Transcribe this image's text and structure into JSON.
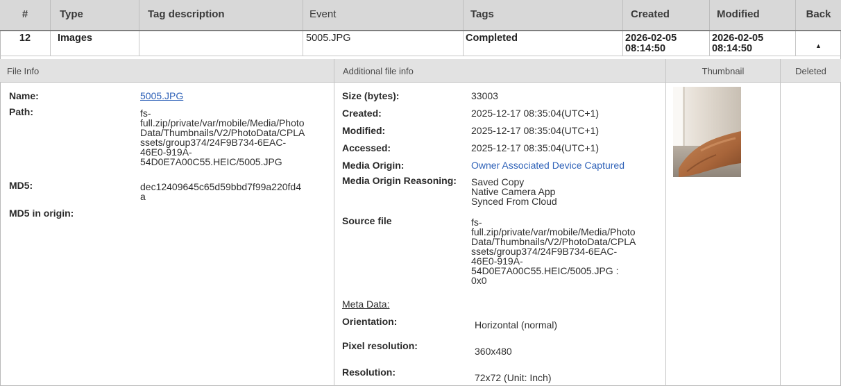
{
  "table": {
    "headers": [
      "#",
      "Type",
      "Tag description",
      "Event",
      "Tags",
      "Created",
      "Modified",
      "Back"
    ],
    "row": {
      "id": "12",
      "type": "Images",
      "tag_description": "",
      "event": "5005.JPG",
      "tags": "Completed",
      "created_date": "2026-02-05",
      "created_time": "08:14:50",
      "modified_date": "2026-02-05",
      "modified_time": "08:14:50",
      "back_icon": "▲"
    }
  },
  "sections": {
    "file_info": "File Info",
    "additional": "Additional file info",
    "thumbnail": "Thumbnail",
    "deleted": "Deleted"
  },
  "file_info": {
    "name_label": "Name:",
    "name_value": "5005.JPG",
    "path_label": "Path:",
    "path_lines": [
      "fs-",
      "full.zip/private/var/mobile/Media/Photo",
      "Data/Thumbnails/V2/PhotoData/CPLA",
      "ssets/group374/24F9B734-6EAC-",
      "46E0-919A-",
      "54D0E7A00C55.HEIC/5005.JPG"
    ],
    "md5_label": "MD5:",
    "md5_lines": [
      "dec12409645c65d59bbd7f99a220fd4",
      "a"
    ],
    "md5_origin_label": "MD5 in origin:"
  },
  "additional": {
    "size_label": "Size (bytes):",
    "size_value": "33003",
    "created_label": "Created:",
    "created_value": "2025-12-17 08:35:04(UTC+1)",
    "modified_label": "Modified:",
    "modified_value": "2025-12-17 08:35:04(UTC+1)",
    "accessed_label": "Accessed:",
    "accessed_value": "2025-12-17 08:35:04(UTC+1)",
    "media_origin_label": "Media Origin:",
    "media_origin_value": "Owner Associated Device Captured",
    "reasoning_label": "Media Origin Reasoning:",
    "reasoning_lines": [
      "Saved Copy",
      "Native Camera App",
      "Synced From Cloud"
    ],
    "source_label": "Source file",
    "source_lines": [
      "fs-",
      "full.zip/private/var/mobile/Media/Photo",
      "Data/Thumbnails/V2/PhotoData/CPLA",
      "ssets/group374/24F9B734-6EAC-",
      "46E0-919A-",
      "54D0E7A00C55.HEIC/5005.JPG :",
      "0x0"
    ],
    "meta_heading": "Meta Data:",
    "orientation_label": "Orientation:",
    "orientation_value": "Horizontal (normal)",
    "pixel_label": "Pixel resolution:",
    "pixel_value": "360x480",
    "resolution_label": "Resolution:",
    "resolution_value": "72x72 (Unit: Inch)"
  },
  "colors": {
    "header_bg": "#d8d8d8",
    "section_bg": "#e2e2e2",
    "link": "#2f62b8"
  }
}
